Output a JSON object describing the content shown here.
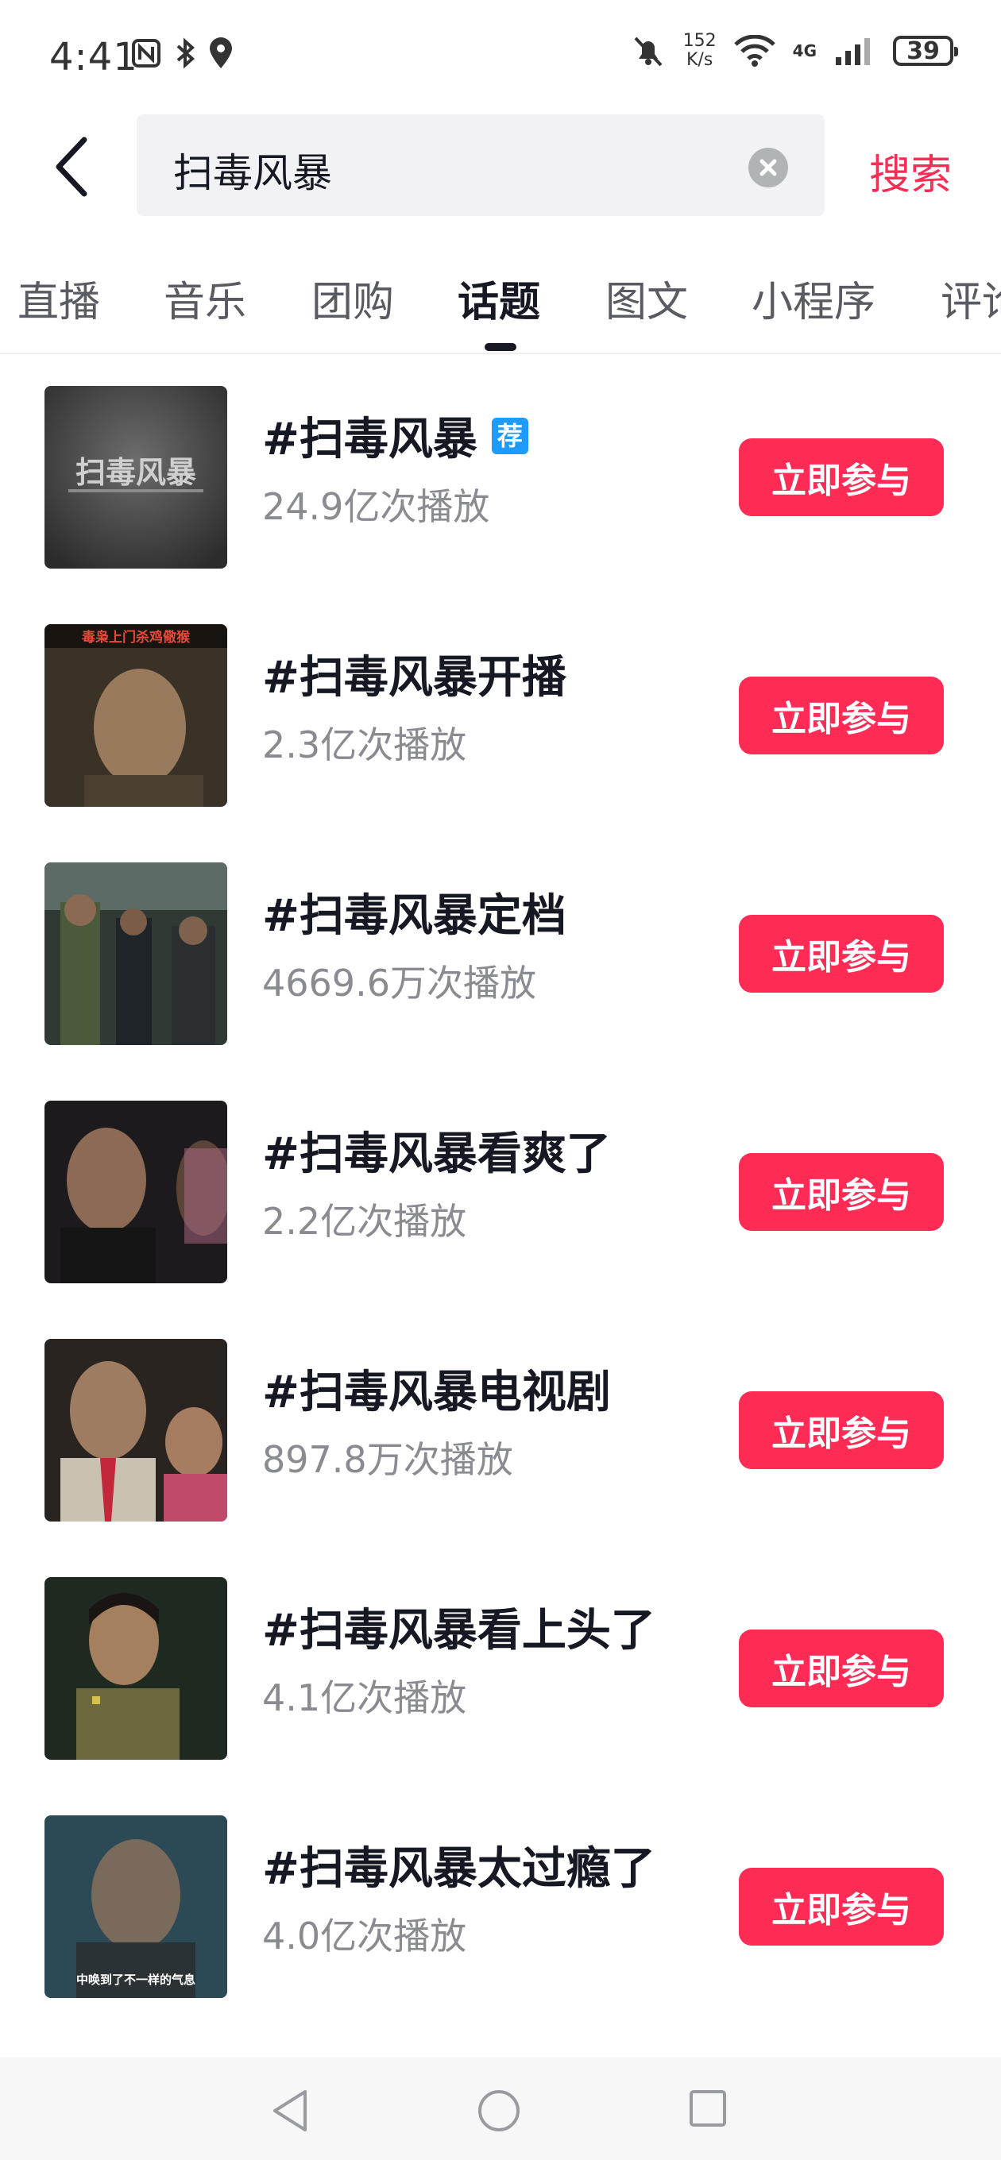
{
  "status_bar": {
    "time": "4:41",
    "speed_value": "152",
    "speed_unit": "K/s",
    "network": "4G",
    "battery": "39"
  },
  "search": {
    "query": "扫毒风暴",
    "search_label": "搜索"
  },
  "tabs": [
    {
      "label": "直播"
    },
    {
      "label": "音乐"
    },
    {
      "label": "团购"
    },
    {
      "label": "话题"
    },
    {
      "label": "图文"
    },
    {
      "label": "小程序"
    },
    {
      "label": "评论"
    }
  ],
  "active_tab": "话题",
  "badge_label": "荐",
  "topics": [
    {
      "title": "#扫毒风暴",
      "plays": "24.9亿次播放",
      "button": "立即参与",
      "thumb_text": "扫毒风暴"
    },
    {
      "title": "#扫毒风暴开播",
      "plays": "2.3亿次播放",
      "button": "立即参与",
      "thumb_text": "毒枭上门杀鸡儆猴"
    },
    {
      "title": "#扫毒风暴定档",
      "plays": "4669.6万次播放",
      "button": "立即参与",
      "thumb_text": ""
    },
    {
      "title": "#扫毒风暴看爽了",
      "plays": "2.2亿次播放",
      "button": "立即参与",
      "thumb_text": ""
    },
    {
      "title": "#扫毒风暴电视剧",
      "plays": "897.8万次播放",
      "button": "立即参与",
      "thumb_text": ""
    },
    {
      "title": "#扫毒风暴看上头了",
      "plays": "4.1亿次播放",
      "button": "立即参与",
      "thumb_text": ""
    },
    {
      "title": "#扫毒风暴太过瘾了",
      "plays": "4.0亿次播放",
      "button": "立即参与",
      "thumb_text": "中唤到了不一样的气息"
    }
  ],
  "colors": {
    "accent": "#fe2c55",
    "badge": "#1e9bff",
    "text": "#161823",
    "subtext": "#8a8b91"
  },
  "icons": {
    "back": "chevron-left-icon",
    "clear": "clear-icon",
    "nav_back": "triangle-back-icon",
    "nav_home": "circle-home-icon",
    "nav_recent": "square-recent-icon"
  }
}
